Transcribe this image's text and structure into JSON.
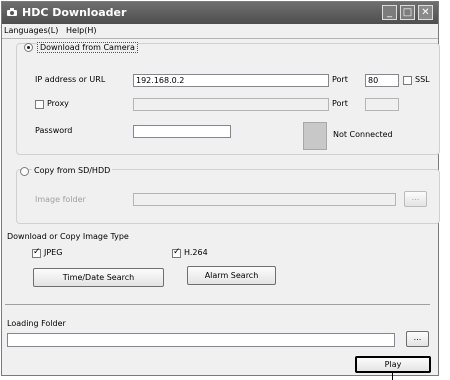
{
  "window": {
    "title": "HDC Downloader",
    "controls": {
      "minimize": "_",
      "maximize": "□",
      "close": "✕"
    }
  },
  "menu": {
    "languages": "Languages(L)",
    "help": "Help(H)"
  },
  "download_section": {
    "radio_label": "Download from Camera",
    "selected": true,
    "ip_label": "IP address or URL",
    "ip_value": "192.168.0.2",
    "port_label": "Port",
    "port_value": "80",
    "ssl_label": "SSL",
    "ssl_checked": false,
    "proxy_label": "Proxy",
    "proxy_checked": false,
    "proxy_value": "",
    "proxy_port_label": "Port",
    "proxy_port_value": "",
    "password_label": "Password",
    "password_value": "",
    "status_text": "Not Connected"
  },
  "copy_section": {
    "radio_label": "Copy from SD/HDD",
    "selected": false,
    "image_folder_label": "Image folder",
    "image_folder_value": "",
    "browse_label": "..."
  },
  "type_section": {
    "label": "Download or Copy Image Type",
    "jpeg_label": "JPEG",
    "jpeg_checked": true,
    "h264_label": "H.264",
    "h264_checked": true,
    "time_date_search_label": "Time/Date Search",
    "alarm_search_label": "Alarm Search"
  },
  "loading_section": {
    "label": "Loading Folder",
    "value": "",
    "browse_label": "...",
    "play_label": "Play"
  }
}
